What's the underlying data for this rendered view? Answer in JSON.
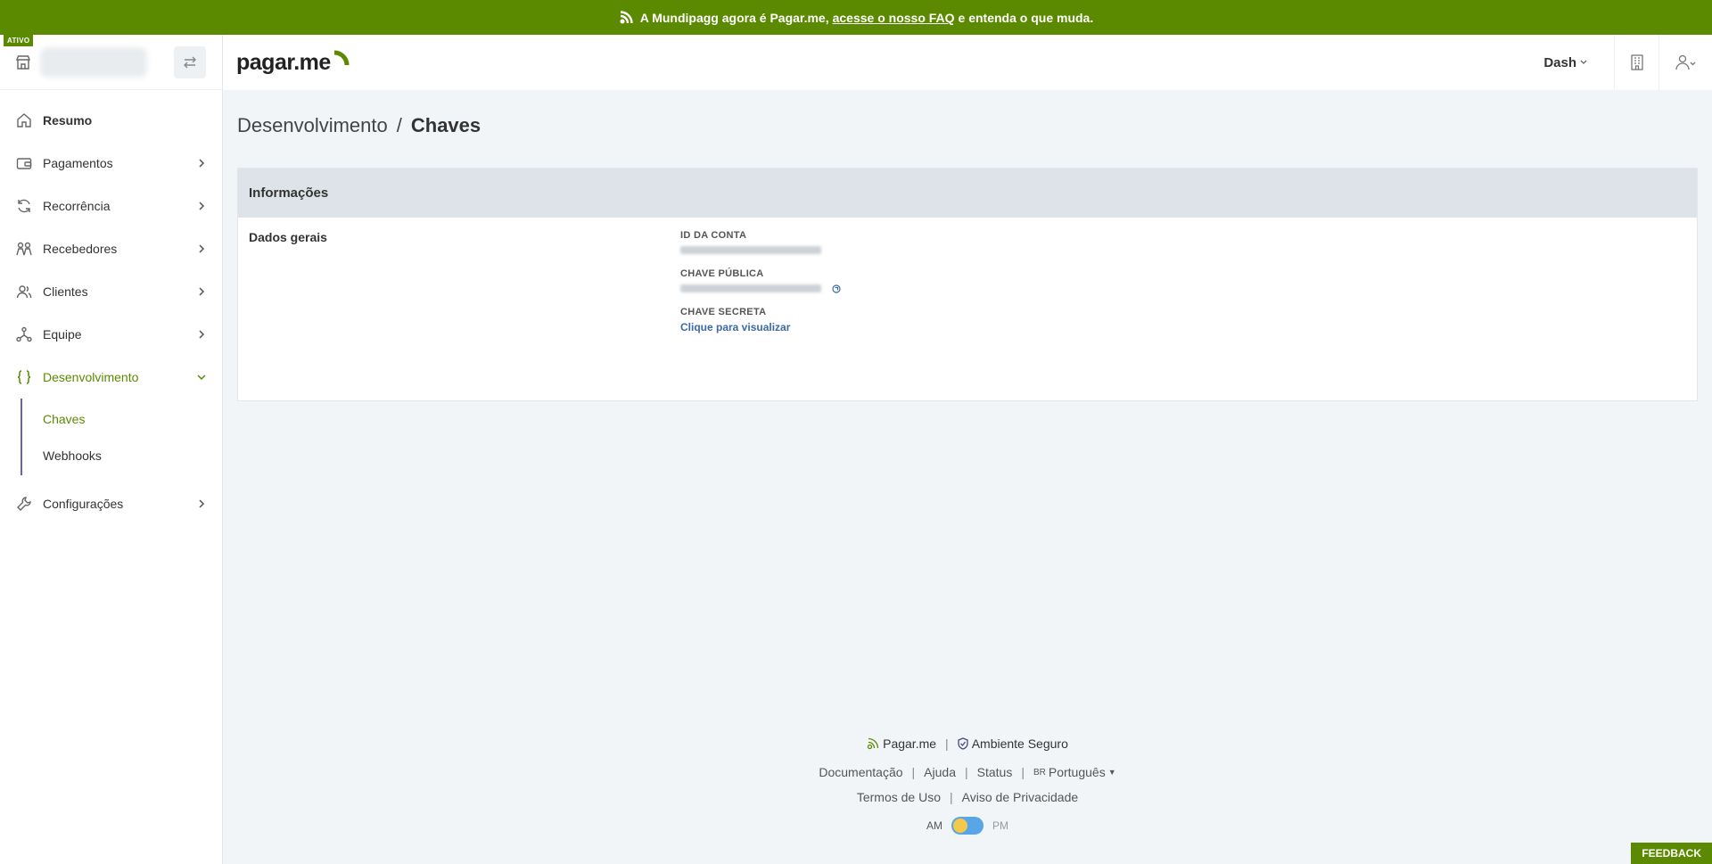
{
  "banner": {
    "prefix": "A Mundipagg agora é Pagar.me,",
    "link": "acesse o nosso FAQ",
    "suffix": "e entenda o que muda."
  },
  "account": {
    "status_badge": "ATIVO"
  },
  "header": {
    "logo": "pagar.me",
    "dash_label": "Dash"
  },
  "sidebar": {
    "items": [
      {
        "label": "Resumo"
      },
      {
        "label": "Pagamentos"
      },
      {
        "label": "Recorrência"
      },
      {
        "label": "Recebedores"
      },
      {
        "label": "Clientes"
      },
      {
        "label": "Equipe"
      },
      {
        "label": "Desenvolvimento"
      },
      {
        "label": "Configurações"
      }
    ],
    "sub_items": [
      {
        "label": "Chaves"
      },
      {
        "label": "Webhooks"
      }
    ]
  },
  "breadcrumb": {
    "parent": "Desenvolvimento",
    "separator": "/",
    "current": "Chaves"
  },
  "card": {
    "title": "Informações",
    "section": "Dados gerais",
    "fields": {
      "account_id_label": "ID DA CONTA",
      "public_key_label": "CHAVE PÚBLICA",
      "secret_key_label": "CHAVE SECRETA",
      "secret_key_action": "Clique para visualizar"
    }
  },
  "footer": {
    "brand": "Pagar.me",
    "secure": "Ambiente Seguro",
    "links": [
      "Documentação",
      "Ajuda",
      "Status"
    ],
    "lang_code": "BR",
    "language": "Português",
    "terms": "Termos de Uso",
    "privacy": "Aviso de Privacidade",
    "am": "AM",
    "pm": "PM"
  },
  "feedback": "FEEDBACK",
  "colors": {
    "brand_green": "#5b8a00",
    "accent_purple": "#6b5fb0",
    "link_blue": "#3a6aa8"
  }
}
